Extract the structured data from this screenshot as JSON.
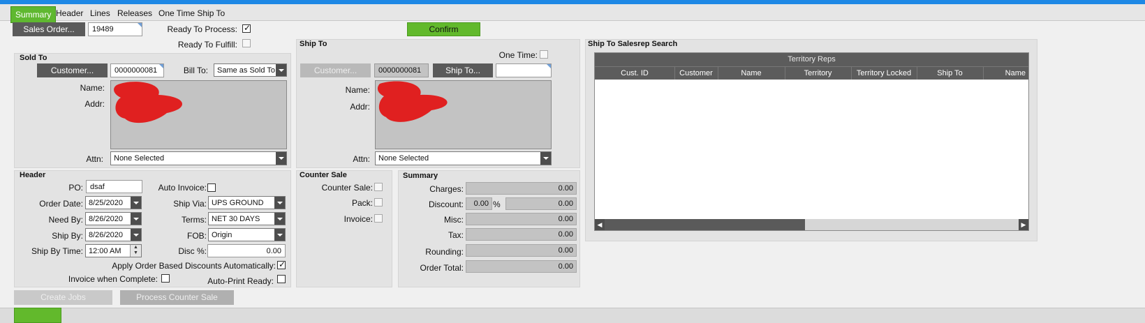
{
  "tabs": [
    "Summary",
    "Header",
    "Lines",
    "Releases",
    "One Time Ship To"
  ],
  "top": {
    "sales_order_btn": "Sales Order...",
    "sales_order_value": "19489",
    "ready_process_label": "Ready To Process:",
    "ready_fulfill_label": "Ready To Fulfill:",
    "confirm_label": "Confirm"
  },
  "sold_to": {
    "title": "Sold To",
    "customer_btn": "Customer...",
    "customer_value": "0000000081",
    "bill_to_label": "Bill To:",
    "bill_to_value": "Same as Sold To",
    "name_label": "Name:",
    "addr_label": "Addr:",
    "attn_label": "Attn:",
    "attn_value": "None Selected"
  },
  "ship_to": {
    "title": "Ship To",
    "one_time_label": "One Time:",
    "customer_btn": "Customer...",
    "customer_value": "0000000081",
    "ship_to_btn": "Ship To...",
    "ship_to_value": "",
    "name_label": "Name:",
    "addr_label": "Addr:",
    "attn_label": "Attn:",
    "attn_value": "None Selected"
  },
  "salesrep": {
    "title": "Ship To Salesrep Search",
    "grid_title": "Territory Reps",
    "columns": [
      "Cust. ID",
      "Customer",
      "Name",
      "Territory",
      "Territory Locked",
      "Ship To",
      "Name"
    ]
  },
  "header": {
    "title": "Header",
    "po_label": "PO:",
    "po_value": "dsaf",
    "order_date_label": "Order Date:",
    "order_date": "8/25/2020",
    "need_by_label": "Need By:",
    "need_by": "8/26/2020",
    "ship_by_label": "Ship By:",
    "ship_by": "8/26/2020",
    "ship_by_time_label": "Ship By Time:",
    "ship_by_time": "12:00 AM",
    "auto_invoice_label": "Auto Invoice:",
    "ship_via_label": "Ship Via:",
    "ship_via": "UPS GROUND",
    "terms_label": "Terms:",
    "terms": "NET 30 DAYS",
    "fob_label": "FOB:",
    "fob": "Origin",
    "disc_label": "Disc %:",
    "disc_value": "0.00",
    "apply_discounts_label": "Apply Order Based Discounts Automatically:",
    "invoice_complete_label": "Invoice when Complete:",
    "auto_print_label": "Auto-Print Ready:"
  },
  "counter_sale": {
    "title": "Counter Sale",
    "counter_sale_label": "Counter Sale:",
    "pack_label": "Pack:",
    "invoice_label": "Invoice:"
  },
  "summary": {
    "title": "Summary",
    "charges_label": "Charges:",
    "charges": "0.00",
    "discount_label": "Discount:",
    "discount_pct": "0.00",
    "pct_sign": "%",
    "discount": "0.00",
    "misc_label": "Misc:",
    "misc": "0.00",
    "tax_label": "Tax:",
    "tax": "0.00",
    "rounding_label": "Rounding:",
    "rounding": "0.00",
    "order_total_label": "Order Total:",
    "order_total": "0.00"
  },
  "bottom": {
    "create_jobs": "Create Jobs",
    "process_counter_sale": "Process Counter Sale"
  },
  "colors": {
    "accent_green": "#62b92c",
    "topbar_blue": "#1e88e5",
    "redaction": "#e02020"
  }
}
